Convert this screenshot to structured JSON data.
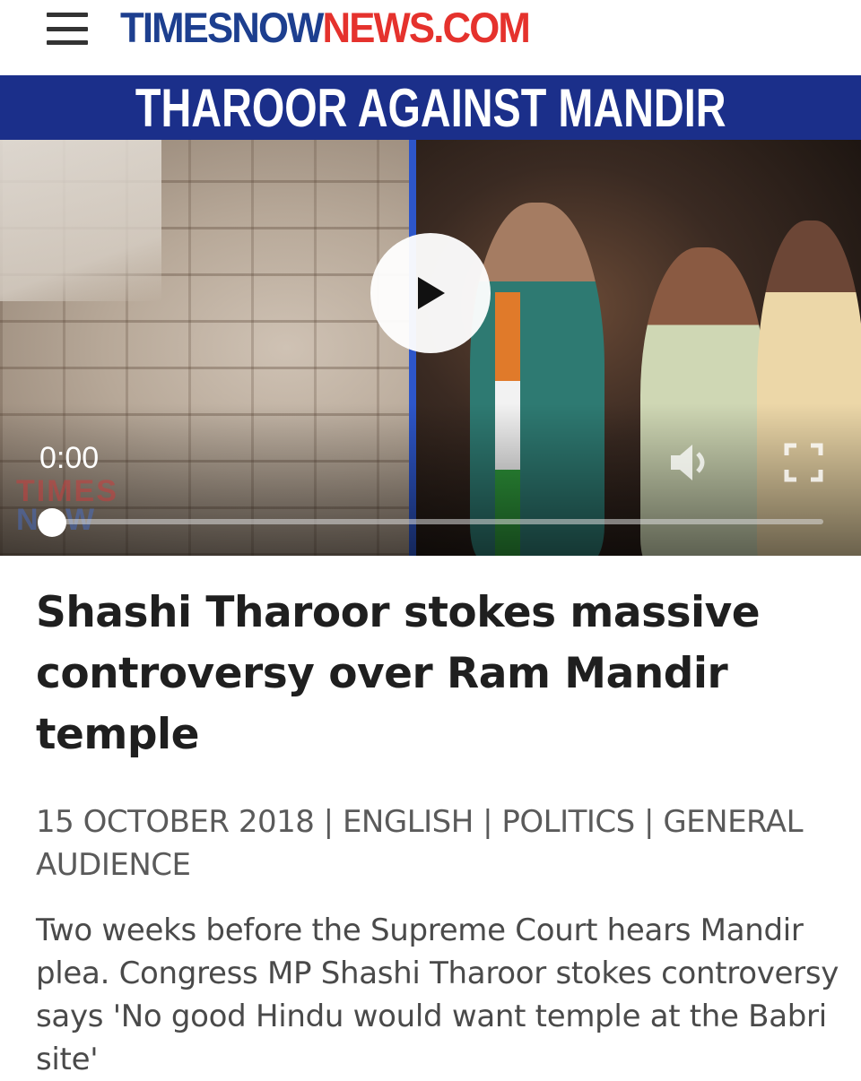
{
  "header": {
    "logo_part1": "TIMESNOW",
    "logo_part2": "NEWS.COM",
    "menu_icon": "hamburger-menu-icon"
  },
  "video": {
    "banner_title": "THAROOR AGAINST MANDIR",
    "watermark_line1": "TIMES",
    "watermark_line2": "NOW",
    "current_time": "0:00",
    "progress_fraction": 0,
    "icons": [
      "play-icon",
      "volume-icon",
      "fullscreen-icon"
    ]
  },
  "article": {
    "headline": "Shashi Tharoor stokes massive controversy over Ram Mandir temple",
    "meta": "15 OCTOBER 2018 | ENGLISH | POLITICS | GENERAL AUDIENCE",
    "summary": "Two weeks before the Supreme Court hears Mandir plea. Congress MP Shashi Tharoor stokes controversy says 'No good Hindu would want temple at the Babri site'"
  },
  "colors": {
    "brand_blue": "#1d3f8f",
    "brand_red": "#e5322d",
    "banner_blue": "#1b2f8a"
  }
}
